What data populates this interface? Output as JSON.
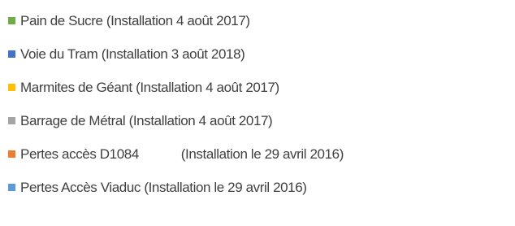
{
  "chart_data": {
    "type": "legend",
    "legend": [
      {
        "label": "Pain de Sucre (Installation 4 août 2017)",
        "color": "#70ad47"
      },
      {
        "label": "Voie du Tram (Installation 3 août 2018)",
        "color": "#4472c4"
      },
      {
        "label": "Marmites de Géant (Installation 4 août 2017)",
        "color": "#ffc000"
      },
      {
        "label": "Barrage de Métral (Installation 4 août 2017)",
        "color": "#a5a5a5"
      },
      {
        "label": "Pertes accès D1084            (Installation le 29 avril 2016)",
        "color": "#ed7d31"
      },
      {
        "label": "Pertes Accès Viaduc (Installation le 29 avril 2016)",
        "color": "#5b9bd5"
      }
    ]
  }
}
